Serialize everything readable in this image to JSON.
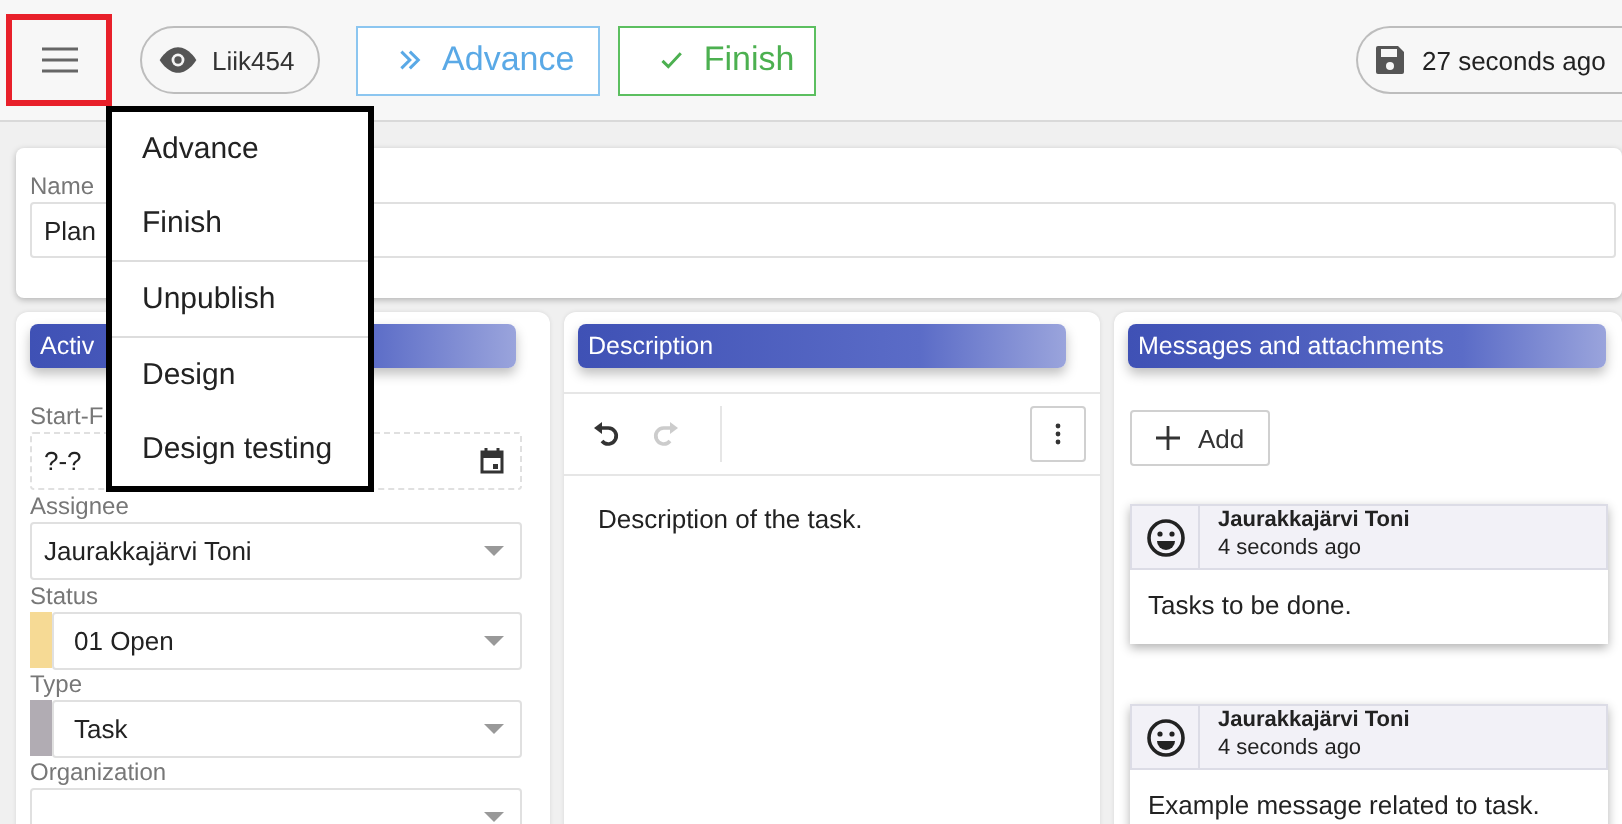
{
  "toolbar": {
    "menu_button": {
      "highlighted": true
    },
    "user_chip": "Liik454",
    "actions": [
      {
        "kind": "advance",
        "label": "Advance"
      },
      {
        "kind": "finish",
        "label": "Finish"
      }
    ],
    "save_status": "27 seconds ago"
  },
  "menu": {
    "items": [
      {
        "label": "Advance",
        "divider_after": false
      },
      {
        "label": "Finish",
        "divider_after": true
      },
      {
        "label": "Unpublish",
        "divider_after": true
      },
      {
        "label": "Design",
        "divider_after": false
      },
      {
        "label": "Design testing",
        "divider_after": false
      }
    ]
  },
  "name_field": {
    "label": "Name",
    "value": "Plan"
  },
  "activity_panel": {
    "title": "Activ",
    "fields": [
      {
        "kind": "date",
        "label": "Start-F",
        "value": "?-?"
      },
      {
        "kind": "select",
        "label": "Assignee",
        "value": "Jaurakkajärvi Toni"
      },
      {
        "kind": "swatch-select",
        "label": "Status",
        "value": "01 Open",
        "color": "#f6da95"
      },
      {
        "kind": "swatch-select",
        "label": "Type",
        "value": "Task",
        "color": "#b1acb3"
      },
      {
        "kind": "select",
        "label": "Organization"
      }
    ]
  },
  "description_panel": {
    "title": "Description",
    "tools": [
      {
        "kind": "undo",
        "disabled": false
      },
      {
        "kind": "redo",
        "disabled": true
      }
    ],
    "text": "Description of the task."
  },
  "messages_panel": {
    "title": "Messages and attachments",
    "add_label": "Add",
    "messages": [
      {
        "author": "Jaurakkajärvi Toni",
        "time": "4 seconds ago",
        "text": "Tasks to be done."
      },
      {
        "author": "Jaurakkajärvi Toni",
        "time": "4 seconds ago",
        "text": "Example message related to task."
      }
    ]
  }
}
